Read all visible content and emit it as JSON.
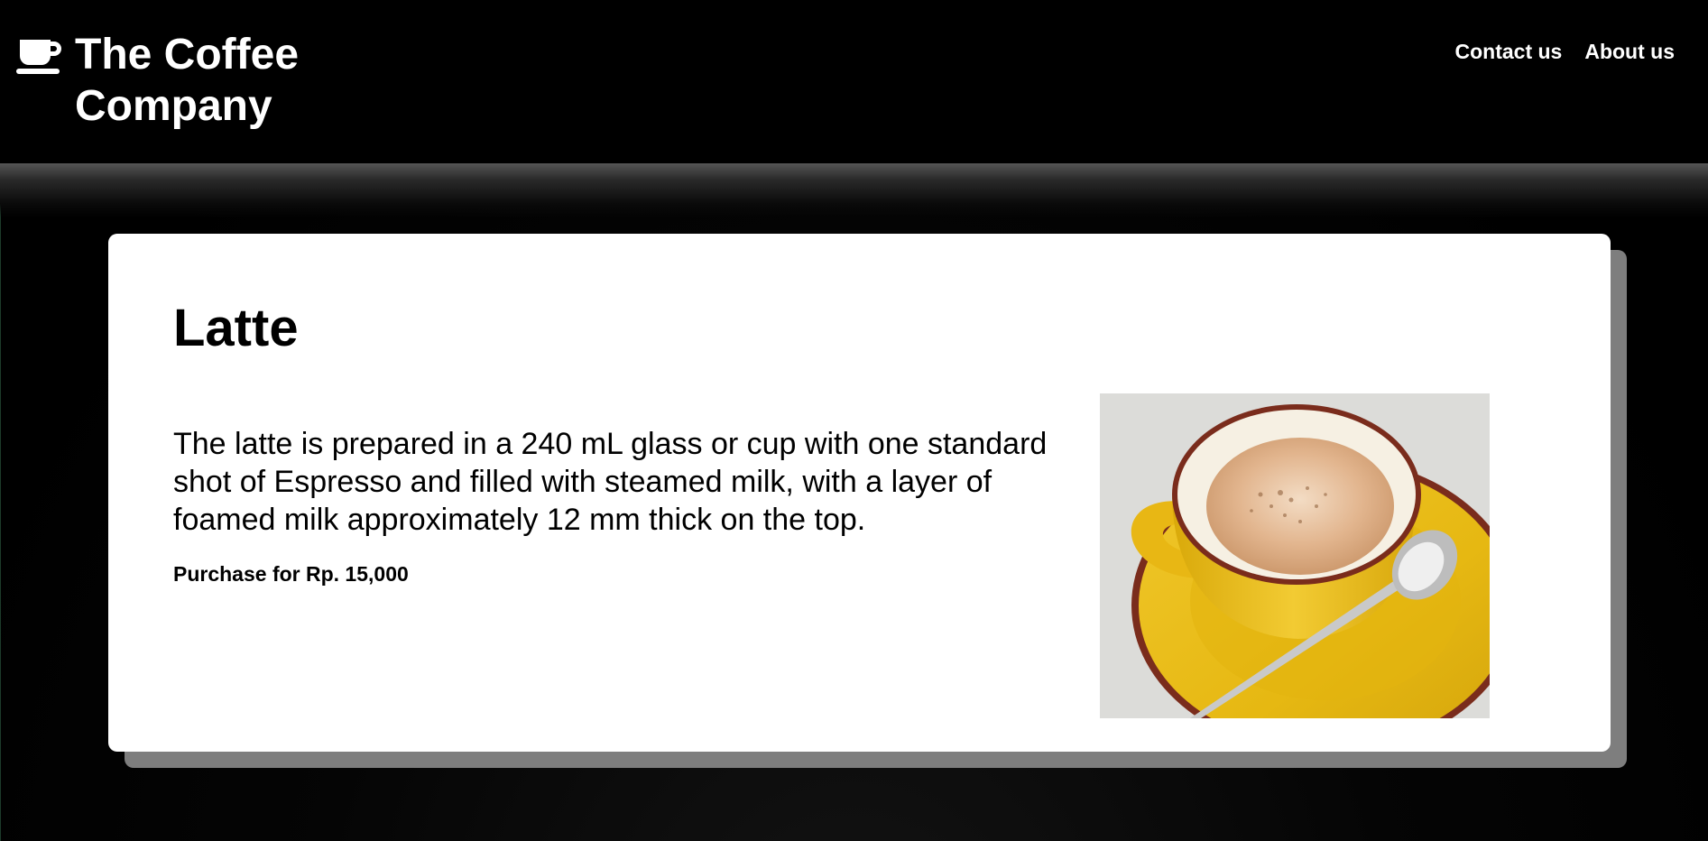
{
  "header": {
    "brand": {
      "icon": "coffee-cup-icon",
      "title": "The Coffee Company"
    },
    "nav": [
      {
        "label": "Contact us"
      },
      {
        "label": "About us"
      }
    ]
  },
  "product": {
    "title": "Latte",
    "description": "The latte is prepared in a 240 mL glass or cup with one standard shot of Espresso and filled with steamed milk, with a layer of foamed milk approximately 12 mm thick on the top.",
    "price": "Purchase for Rp. 15,000",
    "image": "latte-cup-photo"
  },
  "colors": {
    "header_bg": "#000000",
    "card_bg": "#ffffff",
    "card_shadow": "#7e7e7e",
    "text": "#000000",
    "header_text": "#ffffff"
  }
}
